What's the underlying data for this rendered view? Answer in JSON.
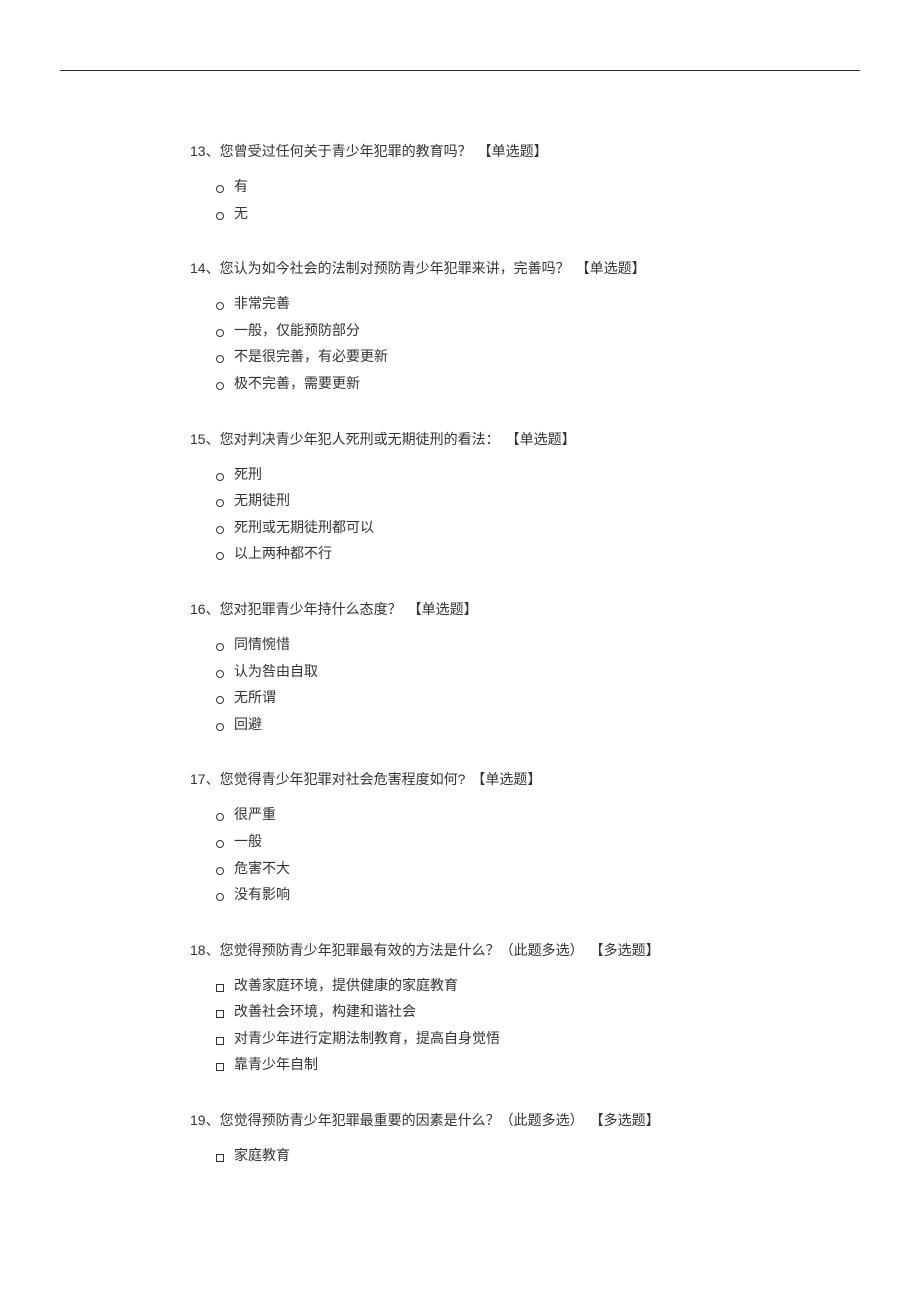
{
  "questions": [
    {
      "number": "13、",
      "text": "您曾受过任何关于青少年犯罪的教育吗？",
      "type": "【单选题】",
      "marker": "circle",
      "options": [
        "有",
        "无"
      ]
    },
    {
      "number": "14、",
      "text": "您认为如今社会的法制对预防青少年犯罪来讲，完善吗？",
      "type": "【单选题】",
      "marker": "circle",
      "options": [
        "非常完善",
        "一般，仅能预防部分",
        "不是很完善，有必要更新",
        "极不完善，需要更新"
      ]
    },
    {
      "number": "15、",
      "text": "您对判决青少年犯人死刑或无期徒刑的看法：",
      "type": "【单选题】",
      "marker": "circle",
      "options": [
        "死刑",
        "无期徒刑",
        "死刑或无期徒刑都可以",
        "以上两种都不行"
      ]
    },
    {
      "number": "16、",
      "text": "您对犯罪青少年持什么态度？",
      "type": "【单选题】",
      "marker": "circle",
      "options": [
        "同情惋惜",
        "认为咎由自取",
        "无所谓",
        "回避"
      ]
    },
    {
      "number": "17、",
      "text": "您觉得青少年犯罪对社会危害程度如何?",
      "type": "【单选题】",
      "marker": "circle",
      "options": [
        "很严重",
        "一般",
        "危害不大",
        "没有影响"
      ]
    },
    {
      "number": "18、",
      "text": "您觉得预防青少年犯罪最有效的方法是什么？（此题多选）",
      "type": "【多选题】",
      "marker": "square",
      "options": [
        "改善家庭环境，提供健康的家庭教育",
        "改善社会环境，构建和谐社会",
        "对青少年进行定期法制教育，提高自身觉悟",
        "靠青少年自制"
      ]
    },
    {
      "number": "19、",
      "text": "您觉得预防青少年犯罪最重要的因素是什么？（此题多选）",
      "type": "【多选题】",
      "marker": "square",
      "options": [
        "家庭教育"
      ]
    }
  ]
}
